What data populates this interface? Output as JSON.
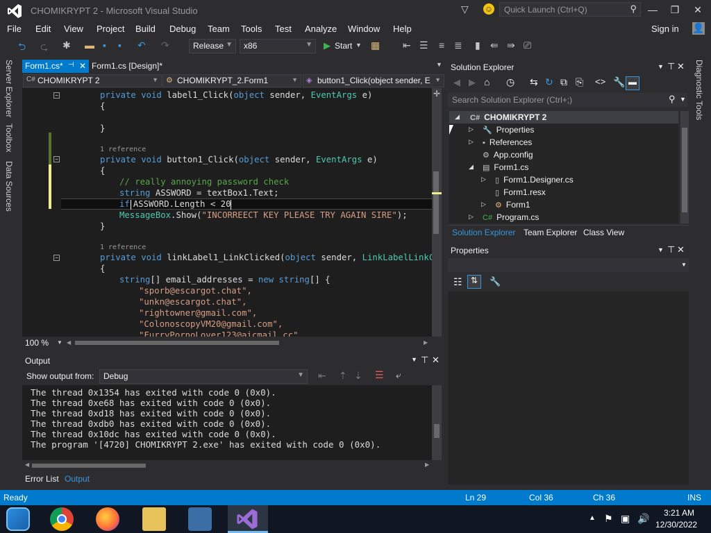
{
  "window": {
    "title": "CHOMIKRYPT 2 - Microsoft Visual Studio",
    "quick_launch_placeholder": "Quick Launch (Ctrl+Q)",
    "sign_in": "Sign in"
  },
  "menu": [
    "File",
    "Edit",
    "View",
    "Project",
    "Build",
    "Debug",
    "Team",
    "Tools",
    "Test",
    "Analyze",
    "Window",
    "Help"
  ],
  "toolbar": {
    "configuration": "Release",
    "platform": "x86",
    "start_label": "Start"
  },
  "left_strip": [
    "Server Explorer",
    "Toolbox",
    "Data Sources"
  ],
  "right_strip": [
    "Diagnostic Tools"
  ],
  "editor": {
    "tabs": [
      {
        "label": "Form1.cs*",
        "active": true
      },
      {
        "label": "Form1.cs [Design]*",
        "active": false
      }
    ],
    "nav": {
      "project": "CHOMIKRYPT 2",
      "class": "CHOMIKRYPT_2.Form1",
      "member": "button1_Click(object sender, E"
    },
    "zoom": "100 %",
    "ref1": "1 reference",
    "ref2": "1 reference",
    "code": {
      "l1a": "private void",
      "l1b": " label1_Click(",
      "l1c": "object",
      "l1d": " sender, ",
      "l1e": "EventArgs",
      "l1f": " e)",
      "brace_open": "{",
      "brace_close": "}",
      "l2a": "private void",
      "l2b": " button1_Click(",
      "l2c": "object",
      "l2d": " sender, ",
      "l2e": "EventArgs",
      "l2f": " e)",
      "comment": "// really annoying password check",
      "l3a": "string",
      "l3b": " ASSWORD = textBox1.Text;",
      "l4a": "if",
      "l4b": "ASSWORD.Length < 20",
      "l5a": "MessageBox",
      "l5b": ".Show(",
      "l5c": "\"INCORREECT KEY PLEASE TRY AGAIN SIRE\"",
      "l5d": ");",
      "l6a": "private void",
      "l6b": " linkLabel1_LinkClicked(",
      "l6c": "object",
      "l6d": " sender, ",
      "l6e": "LinkLabelLinkClic",
      "l7a": "string",
      "l7b": "[] email_addresses = ",
      "l7c": "new",
      "l7d": " ",
      "l7e": "string",
      "l7f": "[] {",
      "e1": "\"sporb@escargot.chat\",",
      "e2": "\"unkn@escargot.chat\",",
      "e3": "\"rightowner@gmail.com\",",
      "e4": "\"ColonoscopyVM20@gmail.com\",",
      "e5": "\"FurryPornoLover123@aicmail.cc\""
    }
  },
  "output": {
    "title": "Output",
    "show_from_label": "Show output from:",
    "show_from_value": "Debug",
    "lines": [
      "The thread 0x1354 has exited with code 0 (0x0).",
      "The thread 0xe68 has exited with code 0 (0x0).",
      "The thread 0xd18 has exited with code 0 (0x0).",
      "The thread 0xdb0 has exited with code 0 (0x0).",
      "The thread 0x10dc has exited with code 0 (0x0).",
      "The program '[4720] CHOMIKRYPT 2.exe' has exited with code 0 (0x0)."
    ],
    "tabs": [
      "Error List",
      "Output"
    ]
  },
  "solution_explorer": {
    "title": "Solution Explorer",
    "search_placeholder": "Search Solution Explorer (Ctrl+;)",
    "tree": {
      "root": "CHOMIKRYPT 2",
      "properties": "Properties",
      "references": "References",
      "appconfig": "App.config",
      "form1": "Form1.cs",
      "designer": "Form1.Designer.cs",
      "resx": "Form1.resx",
      "form1class": "Form1",
      "program": "Program.cs"
    },
    "tabs": [
      "Solution Explorer",
      "Team Explorer",
      "Class View"
    ]
  },
  "properties": {
    "title": "Properties"
  },
  "status": {
    "ready": "Ready",
    "ln": "Ln 29",
    "col": "Col 36",
    "ch": "Ch 36",
    "mode": "INS"
  },
  "clock": {
    "time": "3:21 AM",
    "date": "12/30/2022"
  },
  "colors": {
    "accent": "#007acc",
    "background": "#2d2d30",
    "editor": "#1e1e1e"
  }
}
